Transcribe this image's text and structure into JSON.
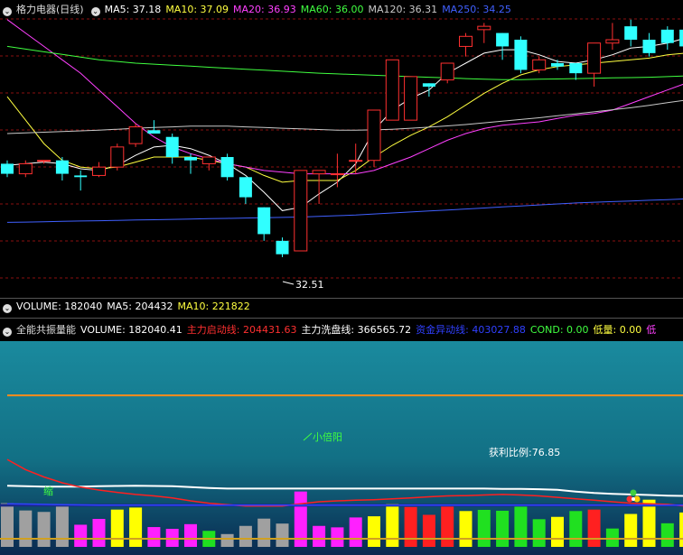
{
  "main_header": {
    "stock_name": "格力电器",
    "period": "(日线)",
    "ma_legend": [
      {
        "label": "MA5:",
        "value": "37.18",
        "color": "#ffffff"
      },
      {
        "label": "MA10:",
        "value": "37.09",
        "color": "#ffff40"
      },
      {
        "label": "MA20:",
        "value": "36.93",
        "color": "#ff40ff"
      },
      {
        "label": "MA60:",
        "value": "36.00",
        "color": "#40ff40"
      },
      {
        "label": "MA120:",
        "value": "36.31",
        "color": "#c8c8c8"
      },
      {
        "label": "MA250:",
        "value": "34.25",
        "color": "#4060ff"
      }
    ]
  },
  "volume_header": {
    "items": [
      {
        "label": "VOLUME:",
        "value": "182040",
        "color": "#ffffff"
      },
      {
        "label": "MA5:",
        "value": "204432",
        "color": "#ffffff"
      },
      {
        "label": "MA10:",
        "value": "221822",
        "color": "#ffff40"
      }
    ]
  },
  "indicator_header": {
    "name": "全能共振量能",
    "items": [
      {
        "label": "VOLUME:",
        "value": "182040.41",
        "color": "#ffffff"
      },
      {
        "label": "主力启动线:",
        "value": "204431.63",
        "color": "#ff3030"
      },
      {
        "label": "主力洗盘线:",
        "value": "366565.72",
        "color": "#ffffff"
      },
      {
        "label": "资金异动线:",
        "value": "403027.88",
        "color": "#3040ff"
      },
      {
        "label": "COND:",
        "value": "0.00",
        "color": "#40ff40"
      },
      {
        "label": "低量:",
        "value": "0.00",
        "color": "#ffff40"
      },
      {
        "label": "低",
        "value": "",
        "color": "#ff40ff"
      }
    ]
  },
  "annotations": {
    "low_price": "32.51",
    "xiao_bei_yang": "小倍阳",
    "profit_ratio": "获利比例:76.85",
    "suo_liang": "缩"
  },
  "chart_data": {
    "type": "candlestick",
    "price_axis": {
      "min": 31.3,
      "max": 39.7
    },
    "candles": [
      {
        "o": 35.3,
        "h": 35.4,
        "l": 34.9,
        "c": 35.0
      },
      {
        "o": 35.0,
        "h": 35.4,
        "l": 34.9,
        "c": 35.3
      },
      {
        "o": 35.4,
        "h": 35.4,
        "l": 35.3,
        "c": 35.4
      },
      {
        "o": 35.4,
        "h": 35.5,
        "l": 34.8,
        "c": 35.0
      },
      {
        "o": 34.95,
        "h": 35.1,
        "l": 34.5,
        "c": 34.9
      },
      {
        "o": 34.95,
        "h": 35.35,
        "l": 34.9,
        "c": 35.2
      },
      {
        "o": 35.2,
        "h": 35.9,
        "l": 35.1,
        "c": 35.8
      },
      {
        "o": 35.9,
        "h": 36.5,
        "l": 35.8,
        "c": 36.4
      },
      {
        "o": 36.3,
        "h": 36.6,
        "l": 36.2,
        "c": 36.2
      },
      {
        "o": 36.1,
        "h": 36.2,
        "l": 35.3,
        "c": 35.5
      },
      {
        "o": 35.5,
        "h": 35.6,
        "l": 35.0,
        "c": 35.4
      },
      {
        "o": 35.3,
        "h": 35.5,
        "l": 35.1,
        "c": 35.5
      },
      {
        "o": 35.5,
        "h": 35.6,
        "l": 34.8,
        "c": 34.9
      },
      {
        "o": 34.9,
        "h": 34.9,
        "l": 34.1,
        "c": 34.3
      },
      {
        "o": 34.0,
        "h": 34.0,
        "l": 33.0,
        "c": 33.2
      },
      {
        "o": 33.0,
        "h": 33.1,
        "l": 32.51,
        "c": 32.6
      },
      {
        "o": 32.7,
        "h": 35.1,
        "l": 32.7,
        "c": 35.1
      },
      {
        "o": 35.0,
        "h": 35.0,
        "l": 34.1,
        "c": 35.1
      },
      {
        "o": 35.0,
        "h": 35.6,
        "l": 34.6,
        "c": 35.0
      },
      {
        "o": 35.4,
        "h": 35.9,
        "l": 35.0,
        "c": 35.4
      },
      {
        "o": 35.4,
        "h": 36.9,
        "l": 35.2,
        "c": 36.9
      },
      {
        "o": 36.6,
        "h": 38.4,
        "l": 36.6,
        "c": 38.4
      },
      {
        "o": 36.6,
        "h": 37.9,
        "l": 36.6,
        "c": 37.9
      },
      {
        "o": 37.7,
        "h": 37.7,
        "l": 37.3,
        "c": 37.6
      },
      {
        "o": 37.8,
        "h": 38.3,
        "l": 37.7,
        "c": 38.3
      },
      {
        "o": 38.8,
        "h": 39.2,
        "l": 38.5,
        "c": 39.1
      },
      {
        "o": 39.3,
        "h": 39.5,
        "l": 38.9,
        "c": 39.4
      },
      {
        "o": 39.2,
        "h": 39.2,
        "l": 38.4,
        "c": 38.8
      },
      {
        "o": 39.0,
        "h": 39.1,
        "l": 38.0,
        "c": 38.1
      },
      {
        "o": 38.1,
        "h": 38.5,
        "l": 38.0,
        "c": 38.4
      },
      {
        "o": 38.3,
        "h": 38.4,
        "l": 38.1,
        "c": 38.2
      },
      {
        "o": 38.3,
        "h": 38.3,
        "l": 37.8,
        "c": 38.0
      },
      {
        "o": 38.0,
        "h": 38.9,
        "l": 37.6,
        "c": 38.9
      },
      {
        "o": 38.9,
        "h": 39.5,
        "l": 38.7,
        "c": 39.0
      },
      {
        "o": 39.4,
        "h": 39.6,
        "l": 38.8,
        "c": 39.0
      },
      {
        "o": 39.0,
        "h": 39.2,
        "l": 38.5,
        "c": 38.6
      },
      {
        "o": 39.3,
        "h": 39.4,
        "l": 38.7,
        "c": 38.9
      },
      {
        "o": 39.3,
        "h": 39.6,
        "l": 38.7,
        "c": 38.8
      }
    ],
    "ma_lines": [
      {
        "name": "MA5",
        "color": "#ffffff",
        "values": [
          35.25,
          35.3,
          35.35,
          35.3,
          35.15,
          35.1,
          35.25,
          35.55,
          35.8,
          35.85,
          35.75,
          35.55,
          35.3,
          34.95,
          34.45,
          33.9,
          34.0,
          34.4,
          34.75,
          35.3,
          36.3,
          36.9,
          37.25,
          37.5,
          38.0,
          38.3,
          38.6,
          38.7,
          38.7,
          38.55,
          38.35,
          38.3,
          38.4,
          38.55,
          38.75,
          38.8,
          38.9,
          39.05
        ]
      },
      {
        "name": "MA10",
        "color": "#ffff40",
        "values": [
          37.3,
          36.6,
          35.9,
          35.4,
          35.2,
          35.15,
          35.2,
          35.35,
          35.5,
          35.5,
          35.5,
          35.4,
          35.3,
          35.2,
          34.95,
          34.75,
          34.8,
          34.8,
          34.8,
          35.1,
          35.5,
          35.85,
          36.15,
          36.4,
          36.7,
          37.05,
          37.4,
          37.7,
          37.95,
          38.1,
          38.2,
          38.25,
          38.3,
          38.35,
          38.4,
          38.45,
          38.55,
          38.6
        ]
      },
      {
        "name": "MA20",
        "color": "#ff40ff",
        "values": [
          39.6,
          39.2,
          38.8,
          38.4,
          38.0,
          37.5,
          37.0,
          36.5,
          36.1,
          35.8,
          35.6,
          35.45,
          35.3,
          35.2,
          35.1,
          35.05,
          35.0,
          35.0,
          35.0,
          35.0,
          35.1,
          35.3,
          35.5,
          35.75,
          36.0,
          36.2,
          36.35,
          36.45,
          36.5,
          36.55,
          36.65,
          36.75,
          36.8,
          36.9,
          37.1,
          37.3,
          37.5,
          37.7
        ]
      },
      {
        "name": "MA60",
        "color": "#40ff40",
        "values": [
          38.8,
          38.72,
          38.64,
          38.56,
          38.48,
          38.4,
          38.35,
          38.3,
          38.27,
          38.24,
          38.21,
          38.18,
          38.15,
          38.12,
          38.09,
          38.06,
          38.03,
          38.0,
          37.98,
          37.96,
          37.94,
          37.92,
          37.9,
          37.88,
          37.86,
          37.84,
          37.82,
          37.81,
          37.81,
          37.82,
          37.83,
          37.84,
          37.85,
          37.86,
          37.87,
          37.88,
          37.9,
          37.92
        ]
      },
      {
        "name": "MA120",
        "color": "#c8c8c8",
        "values": [
          36.2,
          36.22,
          36.24,
          36.26,
          36.28,
          36.3,
          36.33,
          36.36,
          36.38,
          36.4,
          36.42,
          36.42,
          36.42,
          36.4,
          36.38,
          36.36,
          36.34,
          36.32,
          36.3,
          36.3,
          36.31,
          36.33,
          36.36,
          36.39,
          36.43,
          36.47,
          36.52,
          36.57,
          36.62,
          36.67,
          36.73,
          36.79,
          36.85,
          36.91,
          36.97,
          37.04,
          37.12,
          37.2
        ]
      },
      {
        "name": "MA250",
        "color": "#4060ff",
        "values": [
          33.55,
          33.56,
          33.57,
          33.58,
          33.59,
          33.6,
          33.61,
          33.62,
          33.63,
          33.64,
          33.65,
          33.66,
          33.67,
          33.68,
          33.69,
          33.7,
          33.71,
          33.73,
          33.75,
          33.77,
          33.8,
          33.83,
          33.86,
          33.89,
          33.92,
          33.95,
          33.98,
          34.01,
          34.04,
          34.07,
          34.1,
          34.13,
          34.15,
          34.17,
          34.19,
          34.21,
          34.23,
          34.25
        ]
      }
    ],
    "volume": {
      "max": 700000,
      "values": [
        150000,
        125000,
        120000,
        142000,
        76000,
        96000,
        128000,
        135000,
        68000,
        62000,
        78000,
        55000,
        44000,
        72000,
        97000,
        80000,
        190000,
        72000,
        67000,
        101000,
        105000,
        148000,
        137000,
        110000,
        145000,
        123000,
        127000,
        124000,
        147000,
        95000,
        103000,
        123000,
        128000,
        63000,
        113000,
        162000,
        81000,
        118000
      ],
      "colors": [
        "#a0a0a0",
        "#a0a0a0",
        "#a0a0a0",
        "#a0a0a0",
        "#ff20ff",
        "#ff20ff",
        "#ffff00",
        "#ffff00",
        "#ff20ff",
        "#ff20ff",
        "#ff20ff",
        "#20e020",
        "#a0a0a0",
        "#a0a0a0",
        "#a0a0a0",
        "#a0a0a0",
        "#ff20ff",
        "#ff20ff",
        "#ff20ff",
        "#ff20ff",
        "#ffff00",
        "#ffff00",
        "#ff2020",
        "#ff2020",
        "#ff2020",
        "#ffff00",
        "#20e020",
        "#20e020",
        "#20e020",
        "#20e020",
        "#ffff00",
        "#20e020",
        "#ff2020",
        "#20e020",
        "#ffff00",
        "#ffff00",
        "#20e020",
        "#ffff00"
      ],
      "startup_line": {
        "name": "主力启动线",
        "color": "#ff2020",
        "values": [
          300000,
          265000,
          240000,
          220000,
          205000,
          195000,
          187000,
          180000,
          175000,
          168000,
          158000,
          150000,
          145000,
          140000,
          140000,
          140000,
          148000,
          155000,
          158000,
          160000,
          162000,
          165000,
          168000,
          172000,
          175000,
          176000,
          178000,
          180000,
          178000,
          175000,
          170000,
          165000,
          160000,
          155000,
          150000,
          148000,
          146000,
          140000
        ]
      },
      "washout_line": {
        "name": "主力洗盘线",
        "color": "#ffffff",
        "values": [
          210000,
          208000,
          207000,
          207000,
          207000,
          208000,
          209000,
          210000,
          209000,
          208000,
          205000,
          202000,
          200000,
          200000,
          200000,
          200000,
          200000,
          200000,
          200000,
          200000,
          200000,
          200000,
          200000,
          200000,
          200000,
          200000,
          200000,
          199000,
          199000,
          198000,
          196000,
          190000,
          185000,
          182000,
          180000,
          178000,
          176000,
          175000
        ]
      },
      "capital_line": {
        "name": "资金异动线",
        "color": "#3040ff",
        "values": [
          148000,
          147000,
          146000,
          145000,
          144000,
          143000,
          143000,
          143000,
          143000,
          143000,
          143000,
          143000,
          143000,
          143000,
          143000,
          143000,
          143000,
          143000,
          143000,
          143000,
          143000,
          143000,
          143000,
          143000,
          143000,
          143000,
          143000,
          143000,
          143000,
          143000,
          143000,
          143000,
          143000,
          143000,
          143000,
          143000,
          143000,
          143000
        ]
      },
      "level_lines": {
        "orange": 520000,
        "navy_blue": 143000
      }
    }
  }
}
